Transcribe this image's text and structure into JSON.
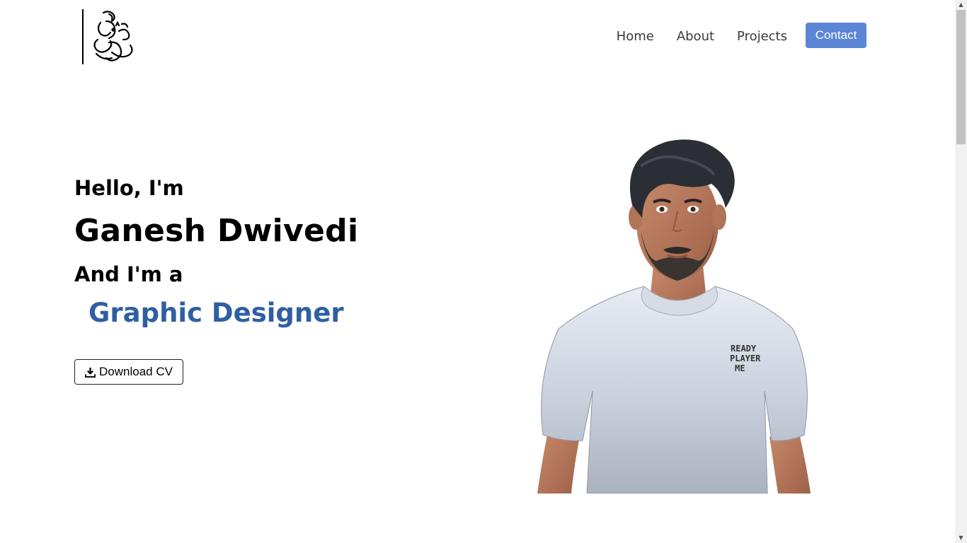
{
  "header": {
    "logo": "ganesha-logo",
    "nav": [
      {
        "label": "Home"
      },
      {
        "label": "About"
      },
      {
        "label": "Projects"
      }
    ],
    "contact_label": "Contact"
  },
  "hero": {
    "greeting": "Hello, I'm",
    "name": "Ganesh Dwivedi",
    "and_text": "And I'm a",
    "role": "Graphic Designer",
    "download_label": "Download CV",
    "download_icon": "download-icon",
    "avatar_shirt_text": [
      "READY",
      "PLAYER",
      "ME"
    ]
  },
  "colors": {
    "accent": "#5c85d6",
    "role_text": "#2f5fa0"
  }
}
